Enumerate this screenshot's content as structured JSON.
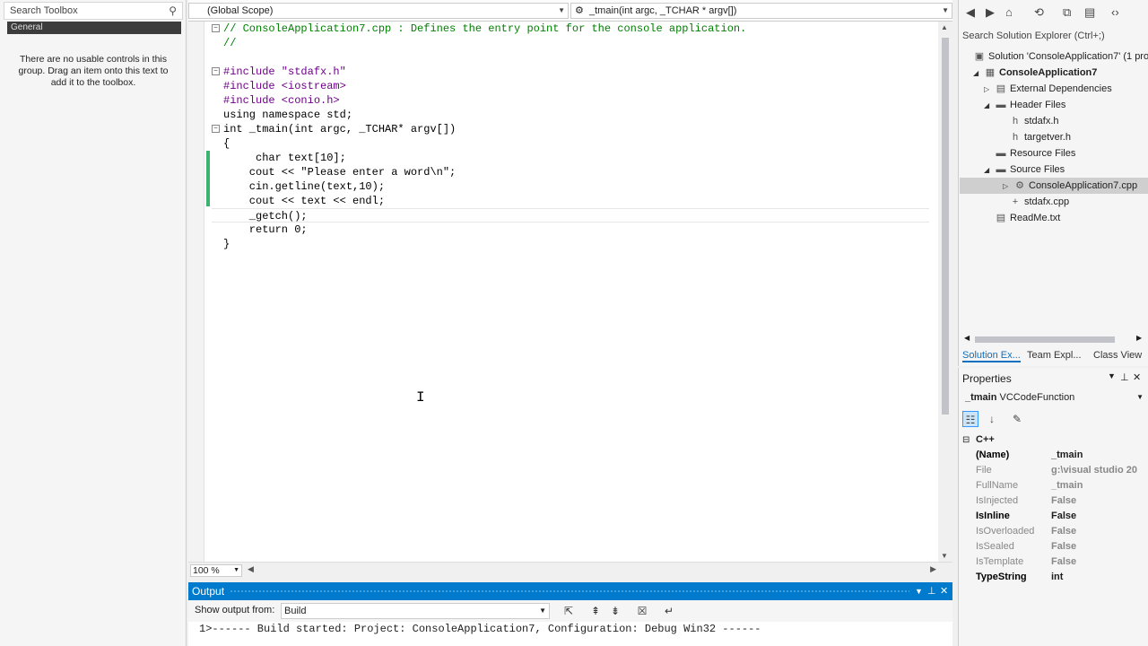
{
  "toolbox": {
    "search_placeholder": "Search Toolbox",
    "group_label": "General",
    "empty_message": "There are no usable controls in this group. Drag an item onto this text to add it to the toolbox."
  },
  "editor": {
    "scope_combo": "(Global Scope)",
    "member_combo": "_tmain(int argc, _TCHAR * argv[])",
    "zoom": "100 %"
  },
  "code_lines": [
    {
      "text": "// ConsoleApplication7.cpp : Defines the entry point for the console application.",
      "kind": "comment",
      "fold": "−"
    },
    {
      "text": "//",
      "kind": "comment",
      "fold": ""
    },
    {
      "text": "",
      "kind": "plain",
      "fold": ""
    },
    {
      "text": "#include \"stdafx.h\"",
      "kind": "include",
      "fold": "−"
    },
    {
      "text": "#include <iostream>",
      "kind": "include",
      "fold": ""
    },
    {
      "text": "#include <conio.h>",
      "kind": "include",
      "fold": ""
    },
    {
      "text": "using namespace std;",
      "kind": "plain",
      "fold": ""
    },
    {
      "text": "int _tmain(int argc, _TCHAR* argv[])",
      "kind": "plain",
      "fold": "−"
    },
    {
      "text": "{",
      "kind": "plain",
      "fold": ""
    },
    {
      "text": "     char text[10];",
      "kind": "plain",
      "fold": ""
    },
    {
      "text": "    cout << \"Please enter a word\\n\";",
      "kind": "plain",
      "fold": ""
    },
    {
      "text": "    cin.getline(text,10);",
      "kind": "plain",
      "fold": ""
    },
    {
      "text": "    cout << text << endl;",
      "kind": "plain",
      "fold": ""
    },
    {
      "text": "    _getch();",
      "kind": "plain",
      "fold": ""
    },
    {
      "text": "    return 0;",
      "kind": "plain",
      "fold": ""
    },
    {
      "text": "}",
      "kind": "plain",
      "fold": ""
    }
  ],
  "output": {
    "title": "Output",
    "show_from_label": "Show output from:",
    "source": "Build",
    "text": "1>------ Build started: Project: ConsoleApplication7, Configuration: Debug Win32 ------"
  },
  "solution_explorer": {
    "search_placeholder": "Search Solution Explorer (Ctrl+;)",
    "nodes": [
      {
        "label": "Solution 'ConsoleApplication7' (1 pro",
        "bold": false
      },
      {
        "label": "ConsoleApplication7",
        "bold": true
      },
      {
        "label": "External Dependencies",
        "bold": false
      },
      {
        "label": "Header Files",
        "bold": false
      },
      {
        "label": "stdafx.h",
        "bold": false
      },
      {
        "label": "targetver.h",
        "bold": false
      },
      {
        "label": "Resource Files",
        "bold": false
      },
      {
        "label": "Source Files",
        "bold": false
      },
      {
        "label": "ConsoleApplication7.cpp",
        "bold": false
      },
      {
        "label": "stdafx.cpp",
        "bold": false
      },
      {
        "label": "ReadMe.txt",
        "bold": false
      }
    ],
    "tabs": [
      "Solution Ex...",
      "Team Expl...",
      "Class View"
    ]
  },
  "properties": {
    "title": "Properties",
    "object": "_tmain",
    "object_type": "VCCodeFunction",
    "category": "C++",
    "rows": [
      {
        "key": "(Name)",
        "value": "_tmain",
        "key_bold": true,
        "value_grey": false
      },
      {
        "key": "File",
        "value": "g:\\visual studio 20",
        "key_bold": false,
        "value_grey": true
      },
      {
        "key": "FullName",
        "value": "_tmain",
        "key_bold": false,
        "value_grey": true
      },
      {
        "key": "IsInjected",
        "value": "False",
        "key_bold": false,
        "value_grey": true
      },
      {
        "key": "IsInline",
        "value": "False",
        "key_bold": true,
        "value_grey": false
      },
      {
        "key": "IsOverloaded",
        "value": "False",
        "key_bold": false,
        "value_grey": true
      },
      {
        "key": "IsSealed",
        "value": "False",
        "key_bold": false,
        "value_grey": true
      },
      {
        "key": "IsTemplate",
        "value": "False",
        "key_bold": false,
        "value_grey": true
      },
      {
        "key": "TypeString",
        "value": "int",
        "key_bold": true,
        "value_grey": false
      }
    ]
  }
}
